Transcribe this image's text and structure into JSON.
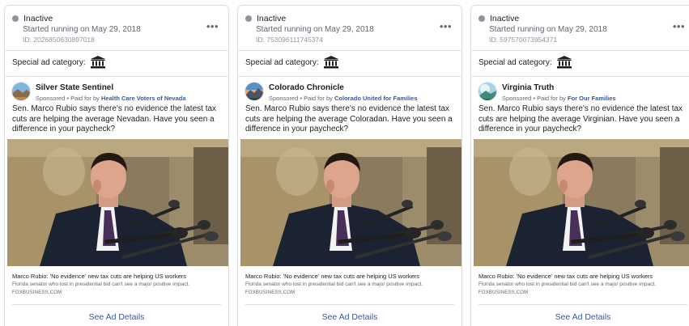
{
  "special_ad_category_label": "Special ad category:",
  "see_details_label": "See Ad Details",
  "more_label": "•••",
  "colors": {
    "inactive_dot": "#8d949e",
    "link_blue": "#385898",
    "border": "#dadde1"
  },
  "cards": [
    {
      "status": "Inactive",
      "started": "Started running on May 29, 2018",
      "id": "ID: 2026850630897018",
      "page_name": "Silver State Sentinel",
      "sponsored": "Sponsored",
      "paid_for_by_prefix": " • Paid for by ",
      "paid_for_by": "Health Care Voters of Nevada",
      "body": "Sen. Marco Rubio says there's no evidence the latest tax cuts are helping the average Nevadan. Have you seen a difference in your paycheck?",
      "link_title": "Marco Rubio: 'No evidence' new tax cuts are helping US workers",
      "link_desc": "Florida senator who lost in presidential bid can't see a major positive impact.",
      "link_domain": "FOXBUSINESS.COM",
      "avatar_icon": "desert-mountain-avatar"
    },
    {
      "status": "Inactive",
      "started": "Started running on May 29, 2018",
      "id": "ID: 753096111745374",
      "page_name": "Colorado Chronicle",
      "sponsored": "Sponsored",
      "paid_for_by_prefix": " • Paid for by ",
      "paid_for_by": "Colorado United for Families",
      "body": "Sen. Marco Rubio says there's no evidence the latest tax cuts are helping the average Coloradan. Have you seen a difference in your paycheck?",
      "link_title": "Marco Rubio: 'No evidence' new tax cuts are helping US workers",
      "link_desc": "Florida senator who lost in presidential bid can't see a major positive impact.",
      "link_domain": "FOXBUSINESS.COM",
      "avatar_icon": "mountain-sunset-avatar"
    },
    {
      "status": "Inactive",
      "started": "Started running on May 29, 2018",
      "id": "ID: 597570073954371",
      "page_name": "Virginia Truth",
      "sponsored": "Sponsored",
      "paid_for_by_prefix": " • Paid for by ",
      "paid_for_by": "For Our Families",
      "body": "Sen. Marco Rubio says there's no evidence the latest tax cuts are helping the average Virginian. Have you seen a difference in your paycheck?",
      "link_title": "Marco Rubio: 'No evidence' new tax cuts are helping US workers",
      "link_desc": "Florida senator who lost in presidential bid can't see a major positive impact.",
      "link_domain": "FOXBUSINESS.COM",
      "avatar_icon": "landscape-avatar"
    }
  ]
}
